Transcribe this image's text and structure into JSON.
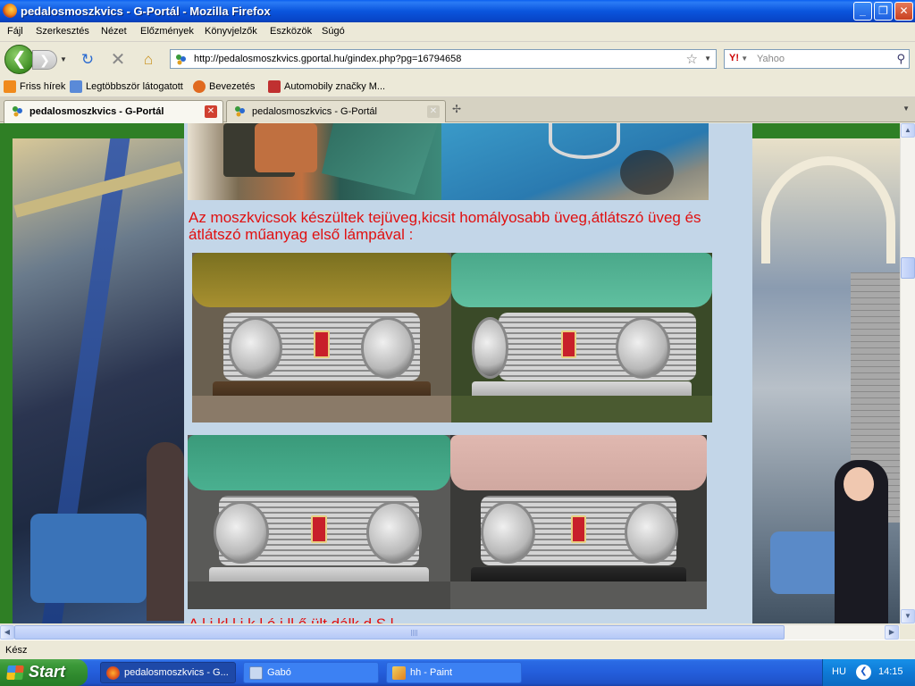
{
  "window": {
    "title": "pedalosmoszkvics - G-Portál - Mozilla Firefox",
    "minimize_glyph": "_",
    "restore_glyph": "❐",
    "close_glyph": "✕"
  },
  "menu": {
    "items": [
      "Fájl",
      "Szerkesztés",
      "Nézet",
      "Előzmények",
      "Könyvjelzők",
      "Eszközök",
      "Súgó"
    ]
  },
  "nav": {
    "url": "http://pedalosmoszkvics.gportal.hu/gindex.php?pg=16794658",
    "search_engine": "Y!",
    "search_placeholder": "Yahoo"
  },
  "bookmarks": [
    {
      "label": "Friss hírek",
      "icon": "rss-icon",
      "color": "#f08a1c"
    },
    {
      "label": "Legtöbbször látogatott",
      "icon": "page-icon",
      "color": "#5a8ad8"
    },
    {
      "label": "Bevezetés",
      "icon": "firefox-icon",
      "color": "#e06a20"
    },
    {
      "label": "Automobily značky M...",
      "icon": "site-icon",
      "color": "#c03030"
    }
  ],
  "tabs": [
    {
      "label": "pedalosmoszkvics - G-Portál",
      "active": true
    },
    {
      "label": "pedalosmoszkvics - G-Portál",
      "active": false
    }
  ],
  "page": {
    "caption": "Az moszkvicsok készültek  tejüveg,kicsit homályosabb üveg,átlátszó üveg és átlátszó műanyag első lámpával :",
    "caption_cut": "A    l   i kl              l i                  k  l    ó  i    ll  ő    ült      dálk  d     S  l"
  },
  "statusbar": {
    "text": "Kész"
  },
  "taskbar": {
    "start_label": "Start",
    "tasks": [
      {
        "label": "pedalosmoszkvics - G...",
        "active": true
      },
      {
        "label": "Gabó",
        "active": false
      },
      {
        "label": "hh - Paint",
        "active": false
      }
    ],
    "language": "HU",
    "clock": "14:15"
  },
  "colors": {
    "caption": "#e01010",
    "content_bg": "#c3d6e8",
    "page_bg": "#2f7f25"
  }
}
